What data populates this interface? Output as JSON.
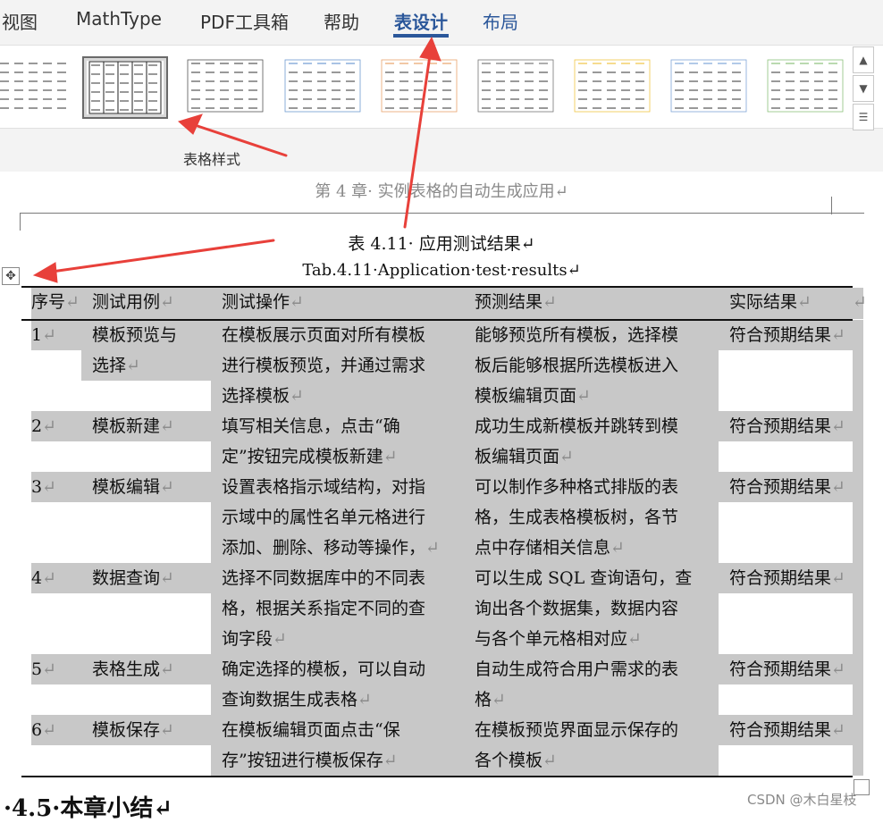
{
  "ribbon": {
    "tabs": [
      {
        "label": "视图",
        "state": "normal"
      },
      {
        "label": "MathType",
        "state": "normal"
      },
      {
        "label": "PDF工具箱",
        "state": "normal"
      },
      {
        "label": "帮助",
        "state": "normal"
      },
      {
        "label": "表设计",
        "state": "active"
      },
      {
        "label": "布局",
        "state": "link"
      }
    ],
    "group_label": "表格样式",
    "style_gallery_accents": [
      "#555555",
      "#222222",
      "#555555",
      "#6f9bd1",
      "#e8a36b",
      "#777777",
      "#f0c544",
      "#7fa6d8",
      "#8cc27a"
    ],
    "selected_style_index": 1
  },
  "document": {
    "running_header": "第 4 章· 实例表格的自动生成应用↵",
    "caption_cn": "表 4.11· 应用测试结果↵",
    "caption_en": "Tab.4.11·Application·test·results↵",
    "table": {
      "headers": [
        "序号↵",
        "测试用例↵",
        "测试操作↵",
        "预测结果↵",
        "实际结果↵"
      ],
      "header_end_mark": "↵",
      "rows": [
        {
          "id": "1↵",
          "case": [
            "模板预览与",
            "选择↵"
          ],
          "op": [
            "在模板展示页面对所有模板",
            "进行模板预览，并通过需求",
            "选择模板↵"
          ],
          "expected": [
            "能够预览所有模板，选择模",
            "板后能够根据所选模板进入",
            "模板编辑页面↵"
          ],
          "actual": "符合预期结果↵"
        },
        {
          "id": "2↵",
          "case": [
            "模板新建↵"
          ],
          "op": [
            "填写相关信息，点击“确",
            "定”按钮完成模板新建↵"
          ],
          "expected": [
            "成功生成新模板并跳转到模",
            "板编辑页面↵"
          ],
          "actual": "符合预期结果↵"
        },
        {
          "id": "3↵",
          "case": [
            "模板编辑↵"
          ],
          "op": [
            "设置表格指示域结构，对指",
            "示域中的属性名单元格进行",
            "添加、删除、移动等操作，↵"
          ],
          "expected": [
            "可以制作多种格式排版的表",
            "格，生成表格模板树，各节",
            "点中存储相关信息↵"
          ],
          "actual": "符合预期结果↵"
        },
        {
          "id": "4↵",
          "case": [
            "数据查询↵"
          ],
          "op": [
            "选择不同数据库中的不同表",
            "格，根据关系指定不同的查",
            "询字段↵"
          ],
          "expected": [
            "可以生成 SQL 查询语句，查",
            "询出各个数据集，数据内容",
            "与各个单元格相对应↵"
          ],
          "actual": "符合预期结果↵"
        },
        {
          "id": "5↵",
          "case": [
            "表格生成↵"
          ],
          "op": [
            "确定选择的模板，可以自动",
            "查询数据生成表格↵"
          ],
          "expected": [
            "自动生成符合用户需求的表",
            "格↵"
          ],
          "actual": "符合预期结果↵"
        },
        {
          "id": "6↵",
          "case": [
            "模板保存↵"
          ],
          "op": [
            "在模板编辑页面点击“保",
            "存”按钮进行模板保存↵"
          ],
          "expected": [
            "在模板预览界面显示保存的",
            "各个模板↵"
          ],
          "actual": "符合预期结果↵"
        }
      ]
    },
    "section_title": "·4.5·本章小结↵"
  },
  "watermark": "CSDN @木白星枝",
  "colors": {
    "accent": "#2b579a",
    "selection_shade": "#c8c8c8",
    "annotation_arrow": "#e8403a"
  }
}
